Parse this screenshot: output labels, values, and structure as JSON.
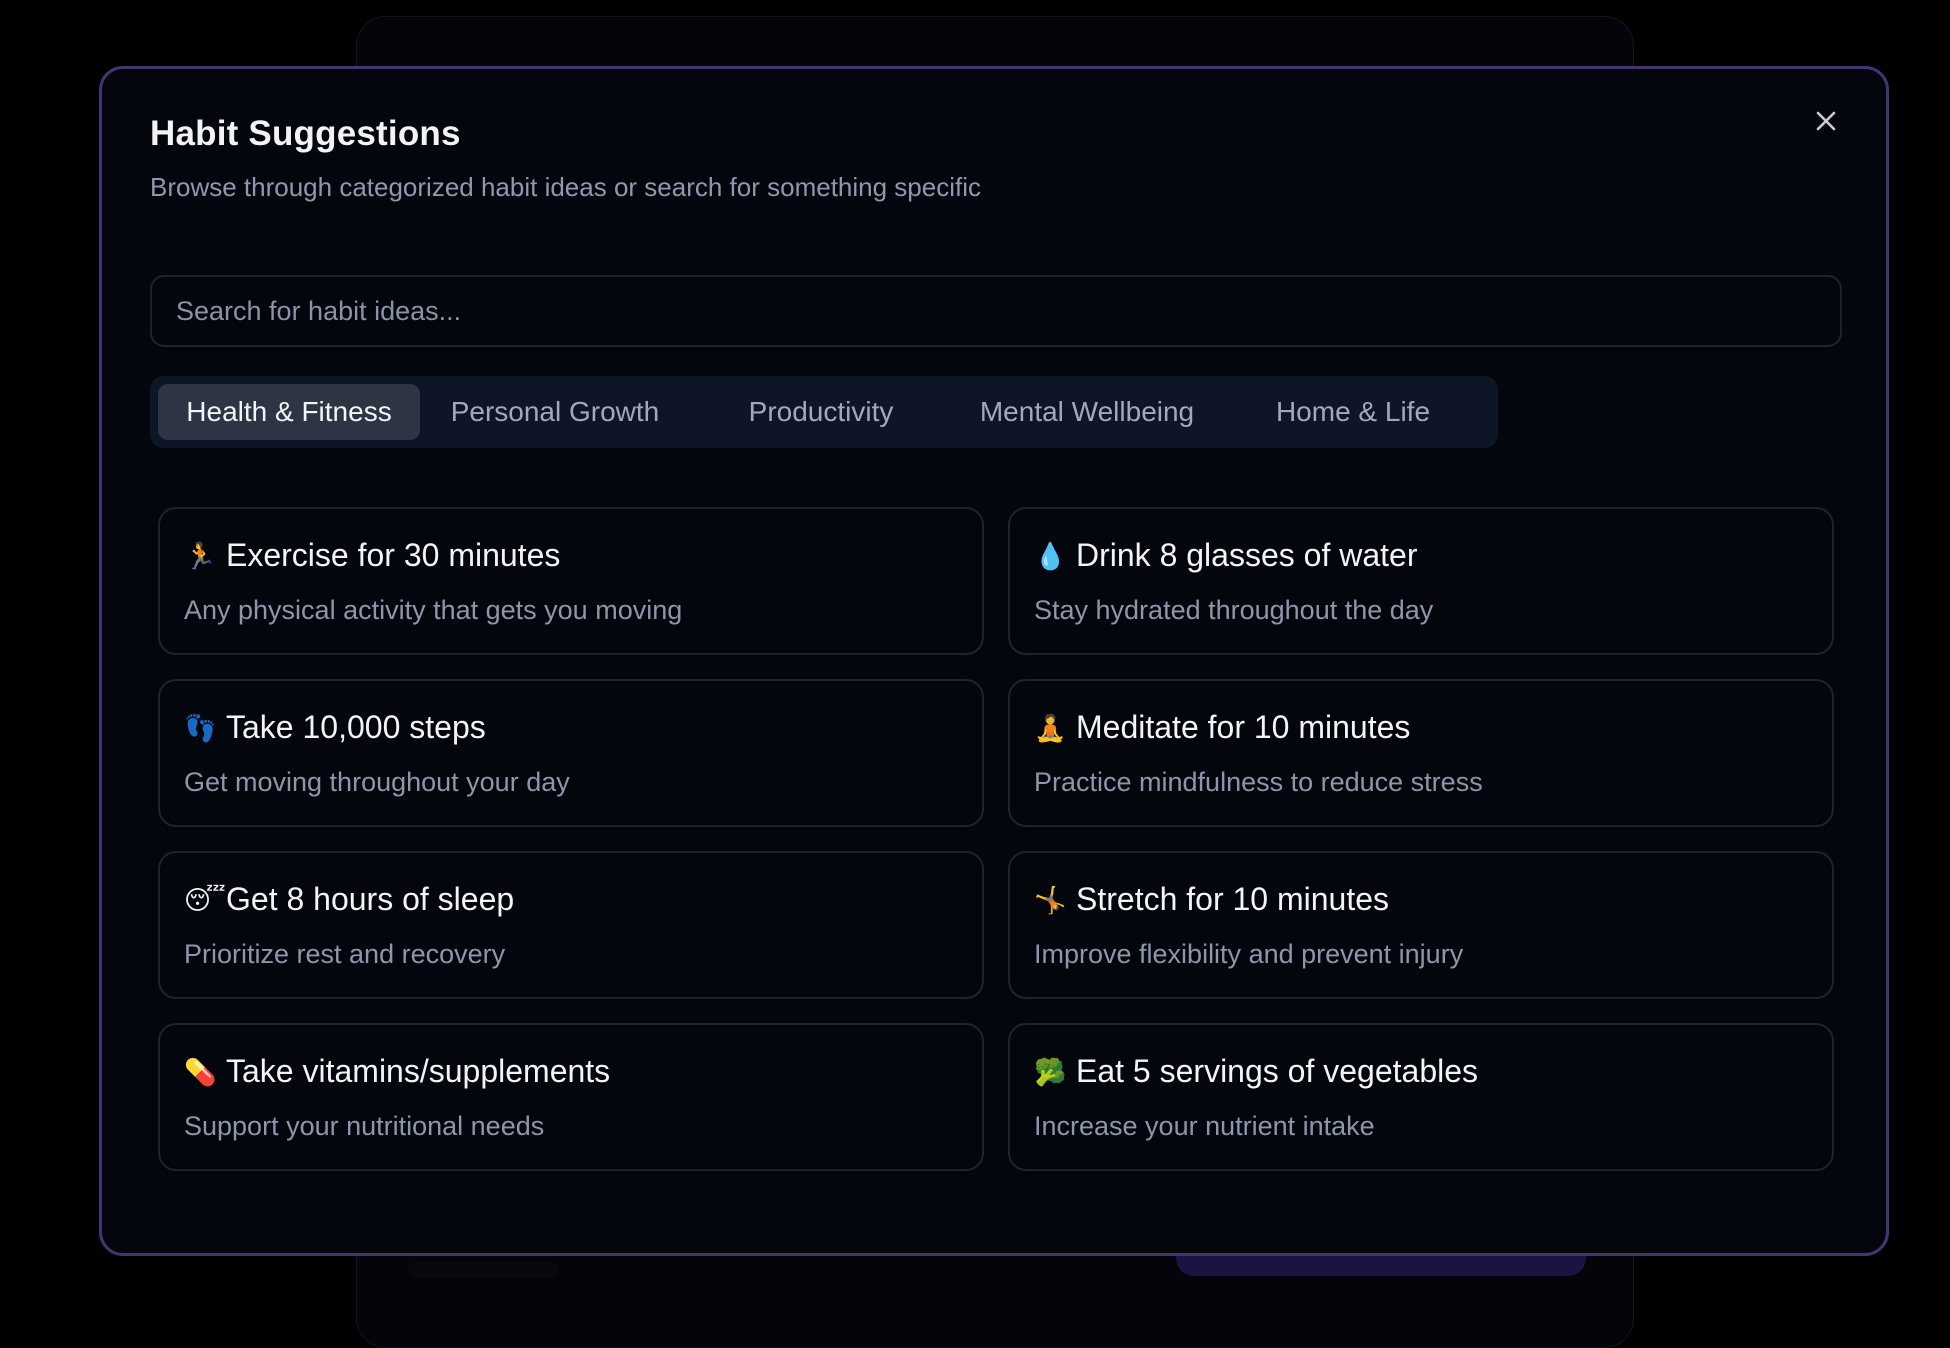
{
  "modal": {
    "title": "Habit Suggestions",
    "subtitle": "Browse through categorized habit ideas or search for something specific",
    "close_icon": "close-icon"
  },
  "search": {
    "placeholder": "Search for habit ideas...",
    "value": ""
  },
  "tabs": [
    {
      "label": "Health & Fitness",
      "active": true
    },
    {
      "label": "Personal Growth",
      "active": false
    },
    {
      "label": "Productivity",
      "active": false
    },
    {
      "label": "Mental Wellbeing",
      "active": false
    },
    {
      "label": "Home & Life",
      "active": false
    }
  ],
  "suggestions": [
    {
      "emoji": "🏃",
      "icon": "running-icon",
      "title": "Exercise for 30 minutes",
      "description": "Any physical activity that gets you moving"
    },
    {
      "emoji": "💧",
      "icon": "water-drop-icon",
      "title": "Drink 8 glasses of water",
      "description": "Stay hydrated throughout the day"
    },
    {
      "emoji": "👣",
      "icon": "footprints-icon",
      "title": "Take 10,000 steps",
      "description": "Get moving throughout your day"
    },
    {
      "emoji": "🧘",
      "icon": "meditation-icon",
      "title": "Meditate for 10 minutes",
      "description": "Practice mindfulness to reduce stress"
    },
    {
      "emoji": "😴",
      "icon": "sleeping-face-icon",
      "title": "Get 8 hours of sleep",
      "description": "Prioritize rest and recovery"
    },
    {
      "emoji": "🤸",
      "icon": "stretching-icon",
      "title": "Stretch for 10 minutes",
      "description": "Improve flexibility and prevent injury"
    },
    {
      "emoji": "💊",
      "icon": "pill-icon",
      "title": "Take vitamins/supplements",
      "description": "Support your nutritional needs"
    },
    {
      "emoji": "🥦",
      "icon": "broccoli-icon",
      "title": "Eat 5 servings of vegetables",
      "description": "Increase your nutrient intake"
    }
  ],
  "colors": {
    "modal_border": "#43356f",
    "modal_background": "#04060d",
    "active_tab": "#2d3444",
    "tab_bar": "#0e1526"
  }
}
